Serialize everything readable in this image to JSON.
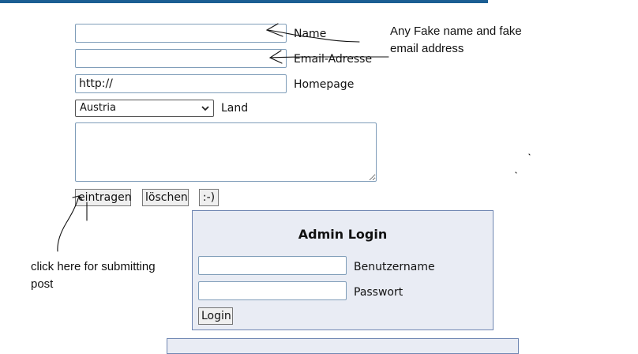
{
  "form": {
    "name_value": "",
    "name_label": "Name",
    "email_value": "",
    "email_label": "Email-Adresse",
    "homepage_value": "http://",
    "homepage_label": "Homepage",
    "country_selected": "Austria",
    "country_label": "Land",
    "message_value": "",
    "submit_label": "eintragen",
    "clear_label": "löschen",
    "smiley_label": ":-)"
  },
  "admin": {
    "title": "Admin Login",
    "username_label": "Benutzername",
    "password_label": "Passwort",
    "login_label": "Login"
  },
  "annotations": {
    "top_note": "Any Fake name and fake email address",
    "bottom_note": "click here for submitting post"
  },
  "colors": {
    "topbar": "#1b5e93",
    "admin_bg": "#e9ecf4",
    "admin_border": "#6f86b2"
  }
}
